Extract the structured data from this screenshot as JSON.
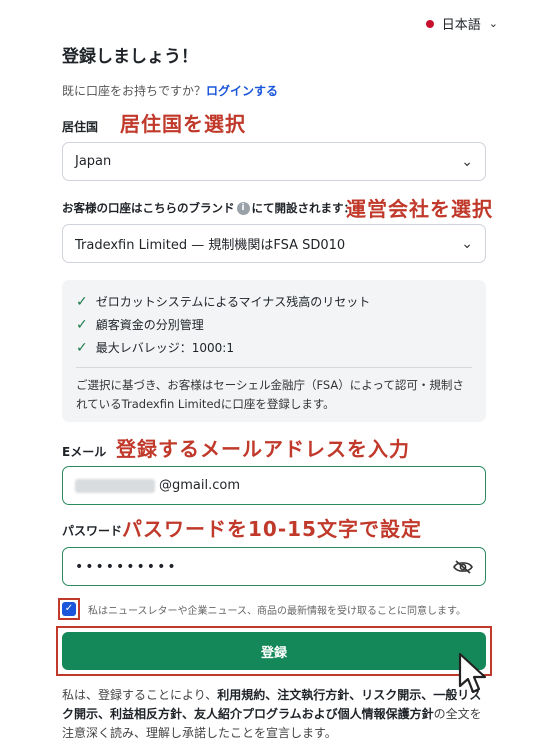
{
  "language": {
    "label": "日本語",
    "flag_color": "#c8102e"
  },
  "title": "登録しましょう！",
  "login": {
    "prompt": "既に口座をお持ちですか？",
    "link": "ログインする"
  },
  "country": {
    "label": "居住国",
    "annotation": "居住国を選択",
    "value": "Japan"
  },
  "brand": {
    "label_before": "お客様の口座はこちらのブランド",
    "label_after": "にて開設されます：",
    "annotation": "運営会社を選択",
    "value": "Tradexfin Limited — 規制機関はFSA SD010"
  },
  "features": {
    "items": [
      "ゼロカットシステムによるマイナス残高のリセット",
      "顧客資金の分別管理",
      "最大レバレッジ：1000:1"
    ],
    "note": "ご選択に基づき、お客様はセーシェル金融庁（FSA）によって認可・規制されているTradexfin Limitedに口座を登録します。"
  },
  "email": {
    "label": "Eメール",
    "annotation": "登録するメールアドレスを入力",
    "value_suffix": "@gmail.com"
  },
  "password": {
    "label": "パスワード",
    "annotation": "パスワードを10-15文字で設定",
    "value": "••••••••••"
  },
  "consent": {
    "text": "私はニュースレターや企業ニュース、商品の最新情報を受け取ることに同意します。"
  },
  "submit": {
    "label": "登録"
  },
  "terms": {
    "prefix": "私は、登録することにより、",
    "docs": "利用規約、注文執行方針、リスク開示、一般リスク開示、利益相反方針、友人紹介プログラムおよび個人情報保護方針",
    "suffix": "の全文を注意深く読み、理解し承諾したことを宣言します。"
  },
  "colors": {
    "accent": "#15885a",
    "annotation": "#c0392b",
    "link": "#1a56db"
  }
}
